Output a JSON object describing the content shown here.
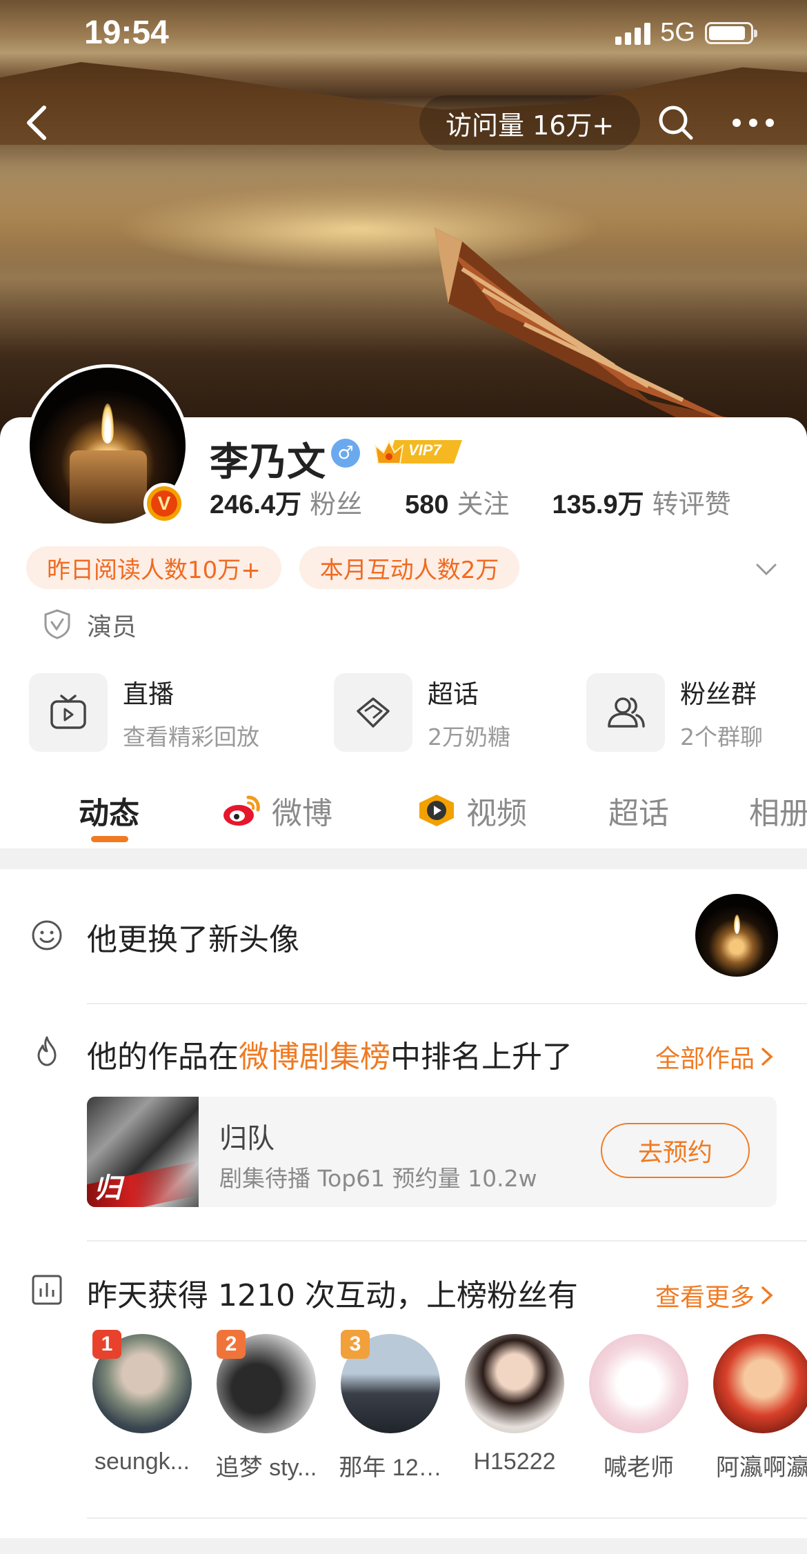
{
  "status_bar": {
    "time": "19:54",
    "network": "5G"
  },
  "nav": {
    "visits": "访问量 16万+"
  },
  "profile": {
    "name": "李乃文",
    "vip_label": "VIP7",
    "verified_letter": "V",
    "gender_symbol": "♂",
    "stats": [
      {
        "value": "246.4万",
        "label": "粉丝"
      },
      {
        "value": "580",
        "label": "关注"
      },
      {
        "value": "135.9万",
        "label": "转评赞"
      }
    ],
    "pills": [
      "昨日阅读人数10万+",
      "本月互动人数2万"
    ],
    "role": "演员"
  },
  "quick_actions": [
    {
      "title": "直播",
      "sub": "查看精彩回放"
    },
    {
      "title": "超话",
      "sub": "2万奶糖"
    },
    {
      "title": "粉丝群",
      "sub": "2个群聊"
    }
  ],
  "tabs": [
    "动态",
    "微博",
    "视频",
    "超话",
    "相册"
  ],
  "feed": {
    "avatar_update": "他更换了新头像",
    "rank_prefix": "他的作品在",
    "rank_highlight": "微博剧集榜",
    "rank_suffix": "中排名上升了",
    "all_works": "全部作品",
    "work": {
      "poster_char": "归",
      "title": "归队",
      "sub": "剧集待播 Top61 预约量 10.2w",
      "button": "去预约"
    },
    "interaction": "昨天获得 1210 次互动，上榜粉丝有",
    "see_more": "查看更多",
    "fans": [
      {
        "rank": "1",
        "name": "seungk..."
      },
      {
        "rank": "2",
        "name": "追梦 sty..."
      },
      {
        "rank": "3",
        "name": "那年 12…"
      },
      {
        "rank": "",
        "name": "H15222"
      },
      {
        "rank": "",
        "name": "喊老师"
      },
      {
        "rank": "",
        "name": "阿瀛啊瀛"
      }
    ]
  },
  "colors": {
    "accent": "#f07a22",
    "pill_bg": "#fdeee6",
    "gender": "#6ba9ee"
  }
}
